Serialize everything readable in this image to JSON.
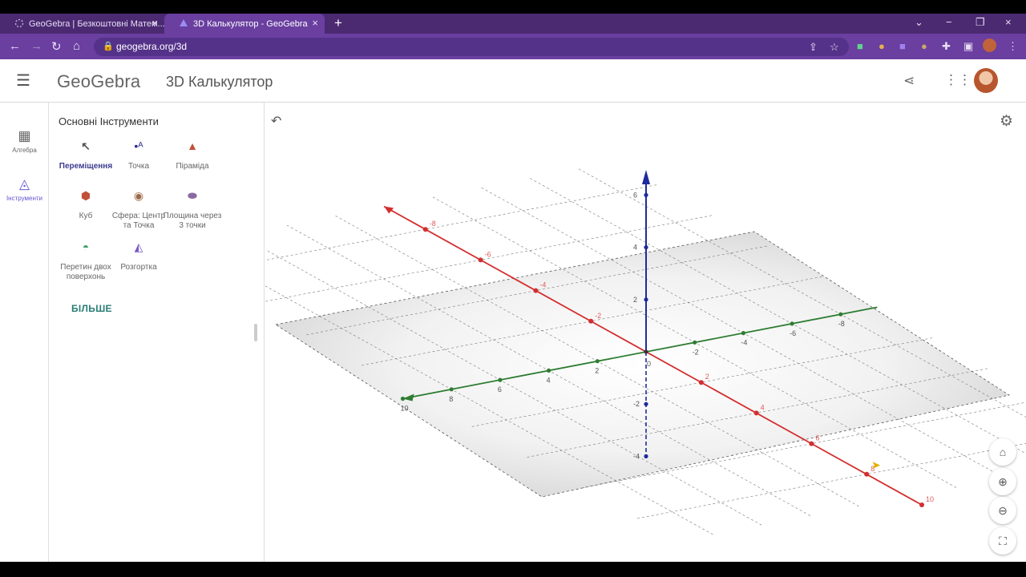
{
  "browser": {
    "tabs": [
      {
        "title": "GeoGebra | Безкоштовні Матем...",
        "close": "×"
      },
      {
        "title": "3D Калькулятор - GeoGebra",
        "close": "×"
      }
    ],
    "new_tab": "+",
    "window_controls": {
      "menu": "⌄",
      "minimize": "−",
      "restore": "❐",
      "close": "×"
    },
    "url": "geogebra.org/3d",
    "nav": {
      "back": "←",
      "forward": "→",
      "reload": "↻",
      "home": "⌂"
    }
  },
  "header": {
    "logo": "GeoGebra",
    "title": "3D Калькулятор"
  },
  "leftbar": {
    "algebra_label": "Алгебра",
    "tools_label": "Інструменти"
  },
  "toolpanel": {
    "title": "Основні Інструменти",
    "tools": [
      {
        "label": "Переміщення",
        "icon": "move-cursor-icon"
      },
      {
        "label": "Точка",
        "icon": "point-icon"
      },
      {
        "label": "Піраміда",
        "icon": "pyramid-icon"
      },
      {
        "label": "Куб",
        "icon": "cube-icon"
      },
      {
        "label": "Сфера: Центр та Точка",
        "icon": "sphere-icon"
      },
      {
        "label": "Площина через 3 точки",
        "icon": "plane-icon"
      },
      {
        "label": "Перетин двох поверхонь",
        "icon": "intersect-surfaces-icon"
      },
      {
        "label": "Розгортка",
        "icon": "net-icon"
      }
    ],
    "more_label": "БІЛЬШЕ"
  },
  "graphics": {
    "axes": {
      "x": {
        "color": "#d32f2f",
        "ticks": [
          "-8",
          "-6",
          "-4",
          "-2",
          "2",
          "4",
          "6",
          "8",
          "10"
        ]
      },
      "y": {
        "color": "#2e7d32",
        "ticks": [
          "10",
          "8",
          "6",
          "4",
          "2",
          "-2",
          "-4",
          "-6",
          "-8"
        ]
      },
      "z": {
        "color": "#1f2a9c",
        "ticks": [
          "6",
          "4",
          "2",
          "-2",
          "-4"
        ]
      },
      "origin": "0"
    }
  },
  "colors": {
    "chrome_tabbar": "#4b2a72",
    "chrome_toolbar": "#6a3fa0",
    "accent": "#6557d2"
  }
}
